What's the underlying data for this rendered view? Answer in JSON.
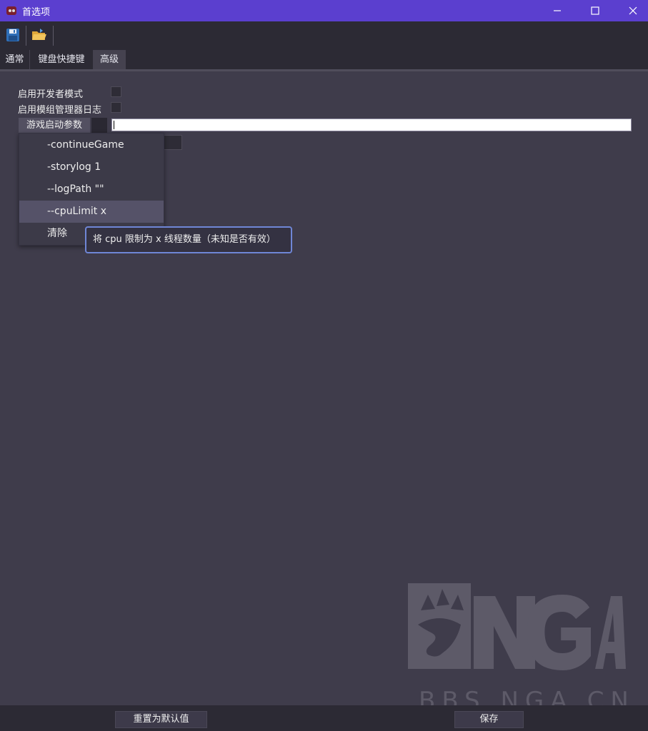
{
  "window": {
    "title": "首选项"
  },
  "toolbar": {
    "save_icon": "save-icon",
    "open_icon": "folder-open-icon"
  },
  "tabs": [
    {
      "label": "通常"
    },
    {
      "label": "键盘快捷键"
    },
    {
      "label": "高级",
      "active": true
    }
  ],
  "settings": {
    "developer_mode_label": "启用开发者模式",
    "mod_manager_log_label": "启用模组管理器日志",
    "launch_args_button": "游戏启动参数",
    "launch_args_value": ""
  },
  "menu": {
    "items": [
      {
        "label": "-continueGame"
      },
      {
        "label": "-storylog 1"
      },
      {
        "label": "--logPath \"\""
      },
      {
        "label": "--cpuLimit x",
        "highlighted": true
      },
      {
        "label": "清除"
      }
    ]
  },
  "tooltip": {
    "text": "将 cpu 限制为 x 线程数量（未知是否有效）"
  },
  "watermark": {
    "logo": "NGA",
    "text": "BBS.NGA.CN"
  },
  "footer": {
    "reset_label": "重置为默认值",
    "save_label": "保存"
  },
  "colors": {
    "titlebar": "#5b3fcf",
    "background": "#3f3c4b",
    "chrome": "#2c2a34",
    "tooltip_border": "#6f86d6"
  }
}
